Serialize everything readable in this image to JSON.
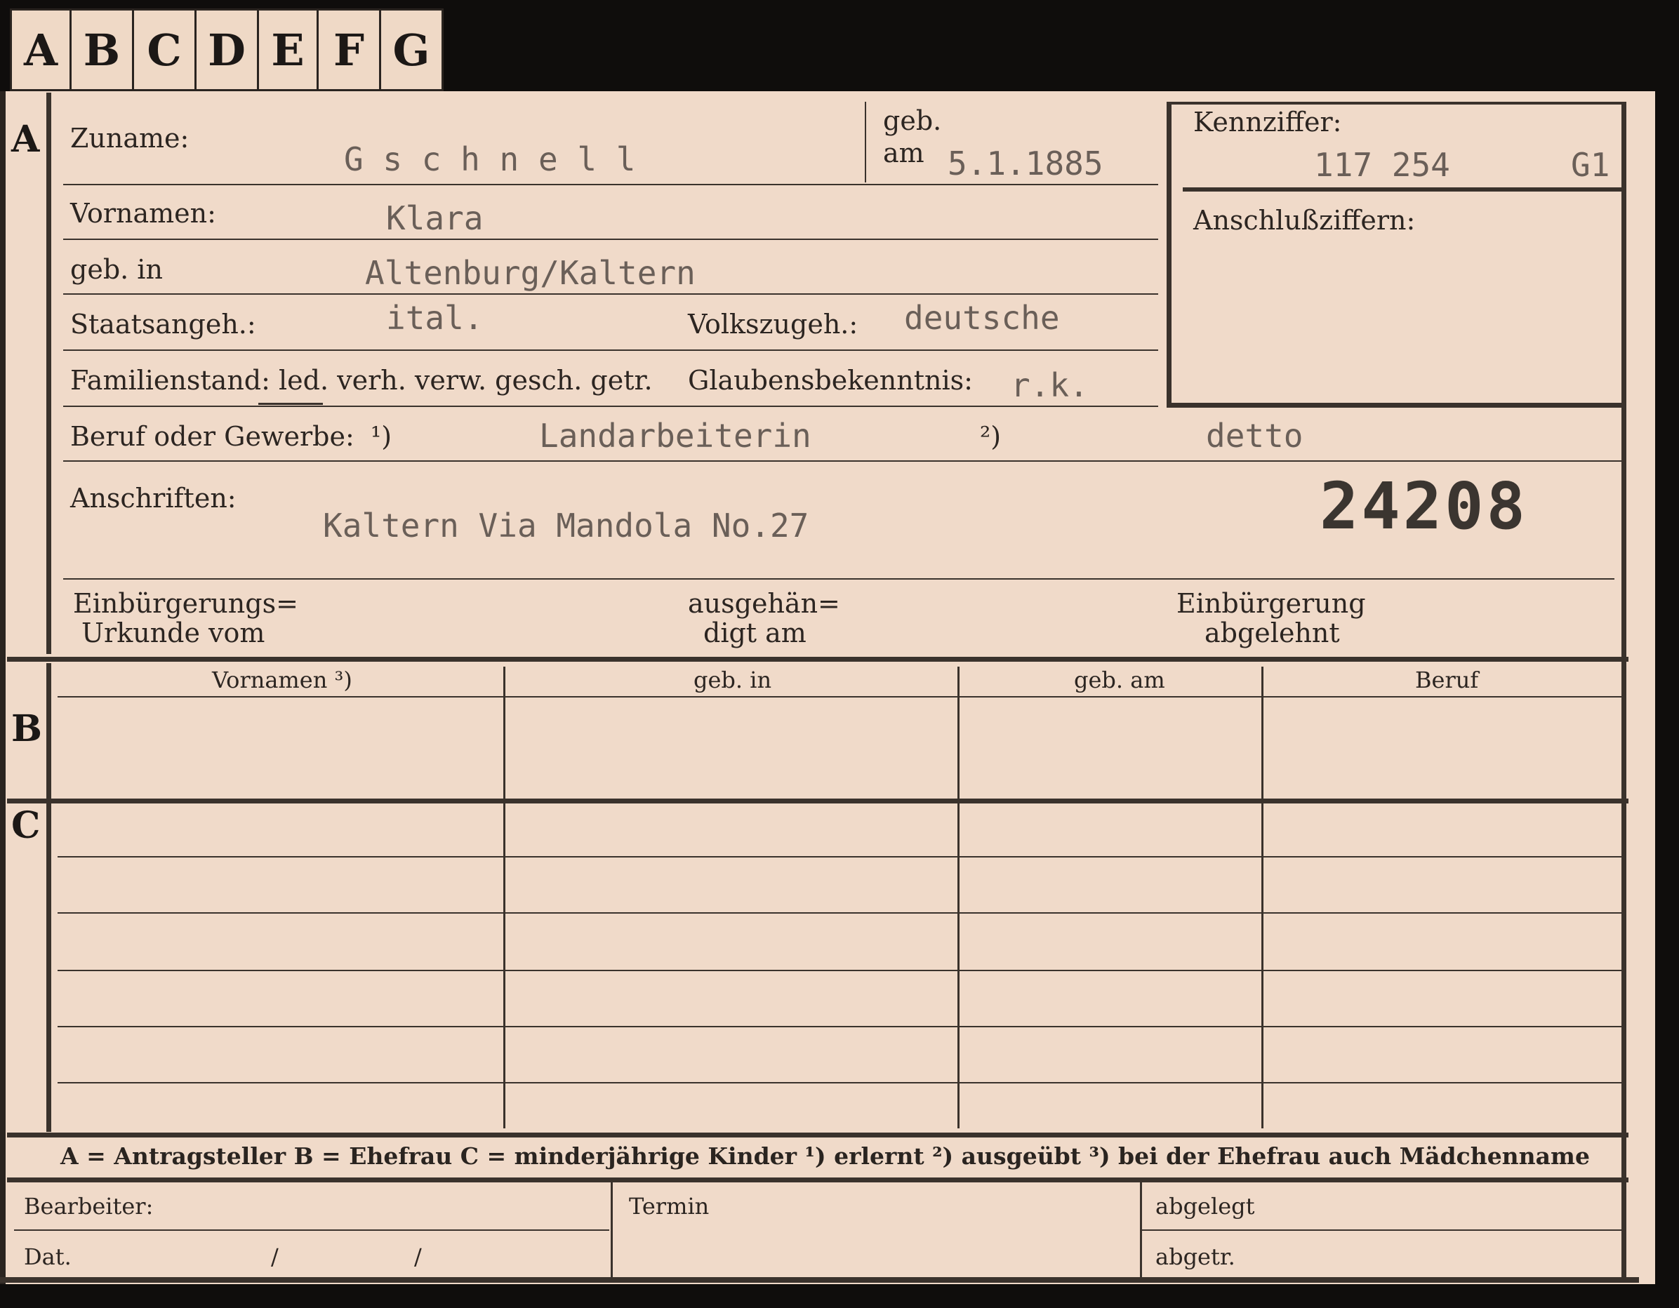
{
  "tabs": [
    "A",
    "B",
    "C",
    "D",
    "E",
    "F",
    "G"
  ],
  "sections": {
    "a": "A",
    "b": "B",
    "c": "C"
  },
  "labels": {
    "zuname": "Zuname:",
    "geb": "geb.",
    "am": "am",
    "vornamen": "Vornamen:",
    "geb_in": "geb. in",
    "staatsangeh": "Staatsangeh.:",
    "volkszugeh": "Volkszugeh.:",
    "familienstand": "Familienstand: led. verh. verw. gesch. getr.",
    "glaubensbekenntnis": "Glaubensbekenntnis:",
    "beruf": "Beruf oder Gewerbe:",
    "beruf_note1": "¹)",
    "beruf_note2": "²)",
    "anschriften": "Anschriften:",
    "kennziffer": "Kennziffer:",
    "anschlussziffern": "Anschlußziffern:",
    "einbuergerung_urkunde_1": "Einbürgerungs=",
    "einbuergerung_urkunde_2": "Urkunde vom",
    "ausgehaendigt_1": "ausgehän=",
    "ausgehaendigt_2": "digt am",
    "einbuergerung_abgelehnt_1": "Einbürgerung",
    "einbuergerung_abgelehnt_2": "abgelehnt"
  },
  "values": {
    "zuname": "G s c h n e l l",
    "geb_am": "5.1.1885",
    "kennziffer_number": "117 254",
    "kennziffer_suffix": "G1",
    "vornamen": "Klara",
    "geb_in": "Altenburg/Kaltern",
    "staatsangeh": "ital.",
    "volkszugeh": "deutsche",
    "glaubensbekenntnis": "r.k.",
    "beruf_erlernt": "Landarbeiterin",
    "beruf_ausgeuebt": "detto",
    "anschriften": "Kaltern Via Mandola No.27",
    "stamp_number": "24208"
  },
  "table_b": {
    "columns": [
      "Vornamen ³)",
      "geb. in",
      "geb. am",
      "Beruf"
    ]
  },
  "legend": "A = Antragsteller   B = Ehefrau   C = minderjährige Kinder   ¹) erlernt   ²) ausgeübt   ³) bei der Ehefrau auch Mädchenname",
  "footer": {
    "bearbeiter": "Bearbeiter:",
    "dat": "Dat.",
    "slash1": "/",
    "slash2": "/",
    "termin": "Termin",
    "abgelegt": "abgelegt",
    "abgetr": "abgetr."
  }
}
